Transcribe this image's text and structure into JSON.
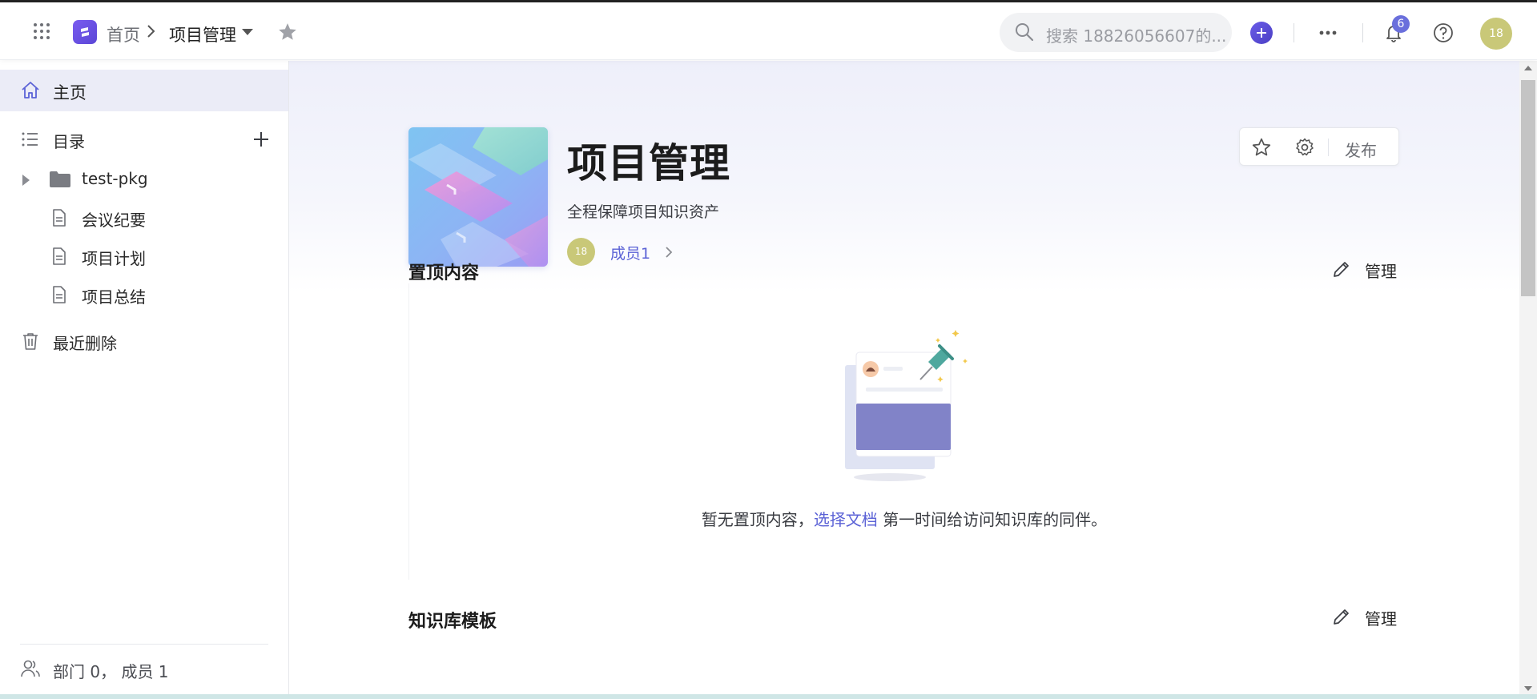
{
  "header": {
    "breadcrumb_home": "首页",
    "breadcrumb_current": "项目管理",
    "search_placeholder": "搜索 18826056607的...",
    "notification_count": "6",
    "avatar_text": "18",
    "icons": [
      "apps-grid-icon",
      "app-logo-icon",
      "chevron-right-icon",
      "caret-down-icon",
      "star-icon",
      "search-icon",
      "plus-icon",
      "more-icon",
      "bell-icon",
      "help-icon"
    ]
  },
  "sidebar": {
    "home_label": "主页",
    "catalog_label": "目录",
    "tree": [
      {
        "label": "test-pkg",
        "type": "folder"
      },
      {
        "label": "会议纪要",
        "type": "doc"
      },
      {
        "label": "项目计划",
        "type": "doc"
      },
      {
        "label": "项目总结",
        "type": "doc"
      }
    ],
    "recent_deleted_label": "最近删除",
    "footer_label": "部门 0， 成员 1"
  },
  "main": {
    "title": "项目管理",
    "description": "全程保障项目知识资产",
    "member_avatar": "18",
    "member_link": "成员1",
    "publish_label": "发布",
    "pinned": {
      "title": "置顶内容",
      "manage_label": "管理",
      "empty_pre": "暂无置顶内容，",
      "empty_link": "选择文档",
      "empty_post": " 第一时间给访问知识库的同伴。"
    },
    "templates": {
      "title": "知识库模板",
      "manage_label": "管理"
    }
  },
  "colors": {
    "accent": "#5b62d6",
    "brand": "#6a5ce8",
    "avatar": "#c9c878",
    "home_active_bg": "#ebecf7"
  }
}
